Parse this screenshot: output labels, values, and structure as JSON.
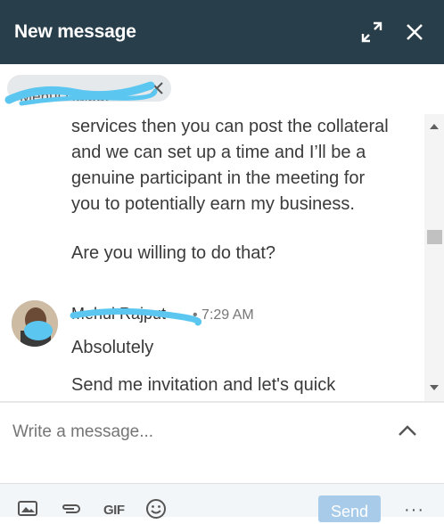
{
  "header": {
    "title": "New message"
  },
  "recipient": {
    "name": "Mehul Rajput"
  },
  "thread": {
    "earlier_message": {
      "paragraph1": "services then you can post the collateral\nand we can set up a time and I’ll be a\ngenuine participant in the meeting for\nyou to potentially earn my business.",
      "paragraph2": "Are you willing to do that?"
    },
    "reply": {
      "sender": "Mehul Rajput",
      "time": "• 7:29 AM",
      "line1": "Absolutely",
      "line2": "Send me invitation and let's quick"
    }
  },
  "compose": {
    "placeholder": "Write a message..."
  },
  "footer": {
    "gif_label": "GIF",
    "send_label": "Send",
    "more_label": "···"
  },
  "colors": {
    "header_bg": "#283e4a",
    "send_button": "#a7cbe8",
    "scribble": "#5bc7f0"
  }
}
